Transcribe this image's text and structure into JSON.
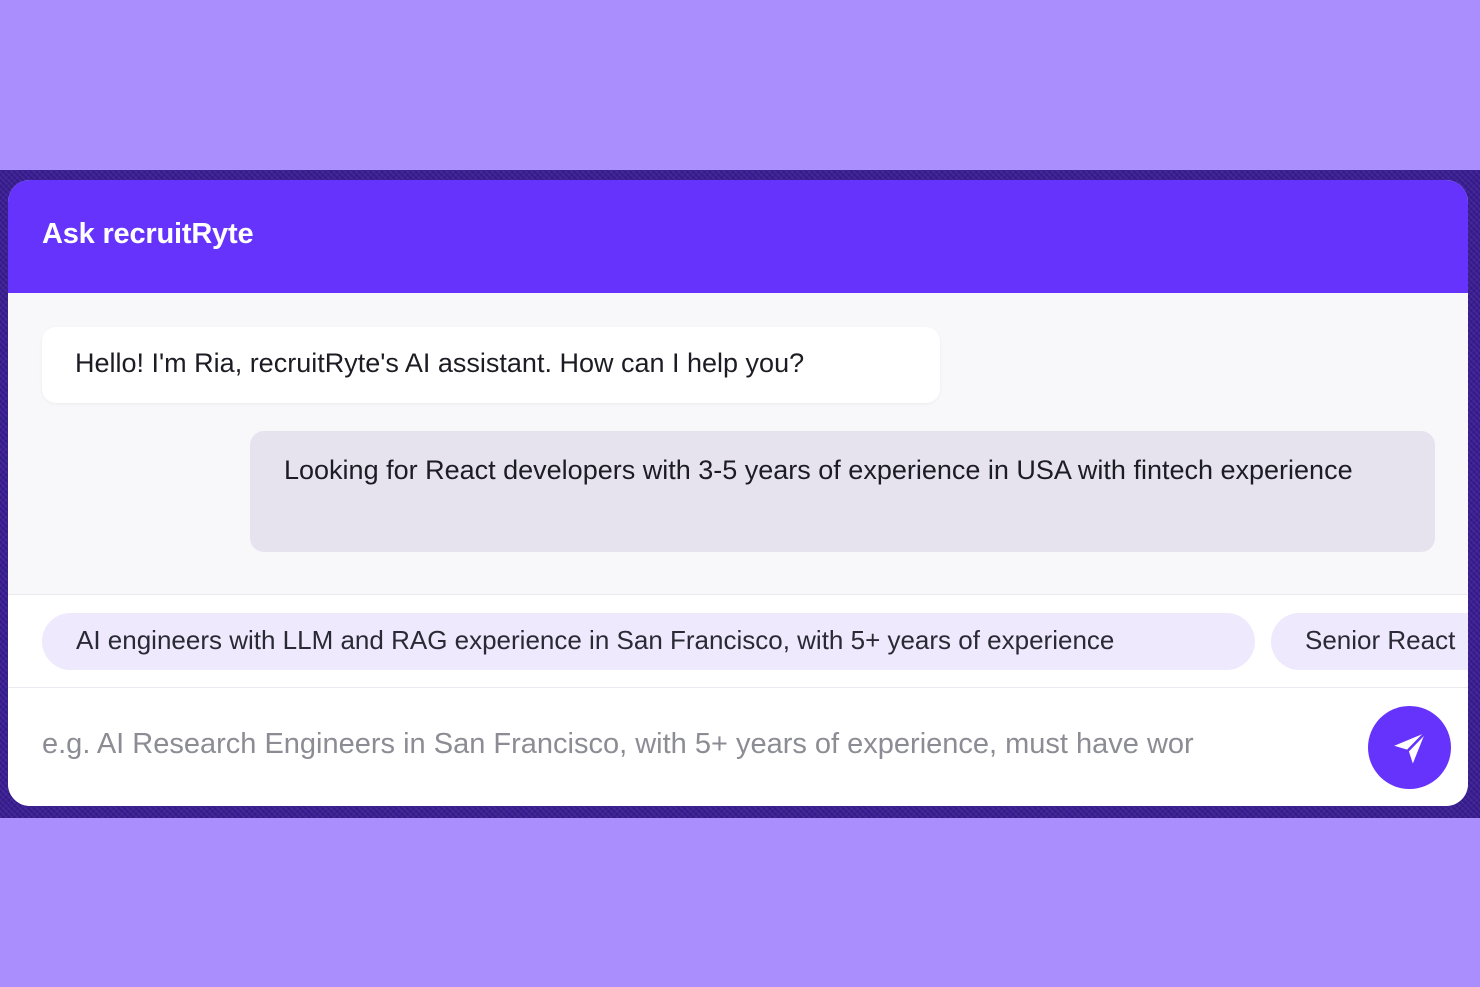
{
  "header": {
    "title": "Ask recruitRyte"
  },
  "messages": [
    {
      "role": "assistant",
      "text": "Hello! I'm Ria, recruitRyte's AI assistant. How can I help you?"
    },
    {
      "role": "user",
      "text": "Looking for React developers with 3-5 years of experience in USA with fintech experience"
    }
  ],
  "suggestions": [
    "AI engineers with LLM and RAG experience in San Francisco, with 5+ years of experience",
    "Senior React"
  ],
  "composer": {
    "placeholder": "e.g. AI Research Engineers in San Francisco, with 5+ years of experience, must have wor",
    "value": "",
    "send_icon": "paper-plane-icon"
  },
  "colors": {
    "page_background": "#aa8efd",
    "brand": "#6633fc",
    "user_bubble": "#e6e3ef",
    "chip": "#eee9fc"
  }
}
